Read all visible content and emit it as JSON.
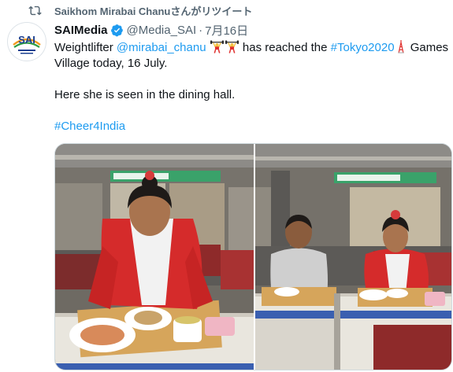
{
  "retweet": {
    "text": "Saikhom Mirabai Chanuさんがリツイート",
    "icon": "retweet-icon"
  },
  "tweet": {
    "avatar_text": "SAI",
    "display_name": "SAIMedia",
    "handle": "@Media_SAI",
    "separator": "·",
    "date": "7月16日",
    "text": {
      "part1": "Weightlifter ",
      "mention": "@mirabai_chanu",
      "part2": " has reached the ",
      "hashtag1": "#Tokyo2020",
      "part3": " Games Village today, 16 July.",
      "line2": "Here she is seen in the dining hall.",
      "hashtag2": "#Cheer4India"
    },
    "emojis": [
      "weightlifter-icon",
      "weightlifter-icon",
      "tokyo-tower-icon"
    ],
    "images": [
      {
        "icon": "photo-dining-hall-athlete"
      },
      {
        "icon": "photo-dining-hall-athlete-coach"
      }
    ]
  },
  "colors": {
    "link": "#1d9bf0",
    "muted": "#536471",
    "verified": "#1d9bf0",
    "jacket": "#d52b2b"
  }
}
